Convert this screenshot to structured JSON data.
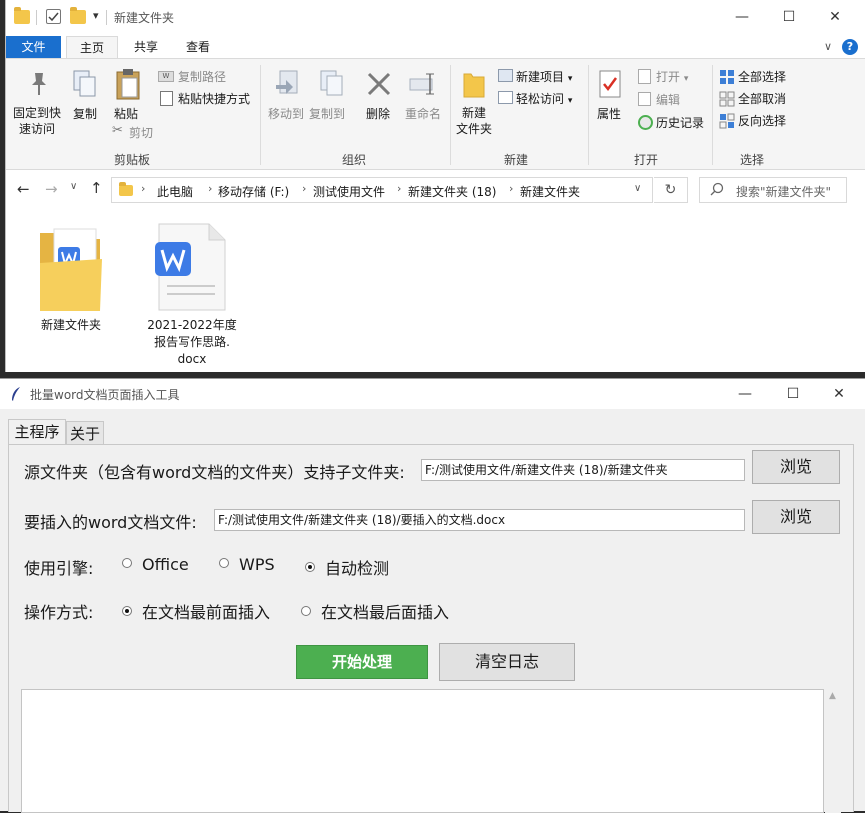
{
  "explorer": {
    "title": "新建文件夹",
    "window_controls": {
      "minimize": "—",
      "maximize": "☐",
      "close": "✕"
    },
    "tabs": [
      "文件",
      "主页",
      "共享",
      "查看"
    ],
    "ribbon": {
      "clipboard": {
        "pin": "固定到快\n速访问",
        "copy": "复制",
        "paste": "粘贴",
        "copy_path": "复制路径",
        "paste_shortcut": "粘贴快捷方式",
        "cut": "剪切",
        "group": "剪贴板"
      },
      "organize": {
        "move_to": "移动到",
        "copy_to": "复制到",
        "delete": "删除",
        "rename": "重命名",
        "group": "组织"
      },
      "new": {
        "new_folder": "新建\n文件夹",
        "new_item": "新建项目",
        "easy_access": "轻松访问",
        "group": "新建"
      },
      "open": {
        "properties": "属性",
        "open": "打开",
        "edit": "编辑",
        "history": "历史记录",
        "group": "打开"
      },
      "select": {
        "select_all": "全部选择",
        "select_none": "全部取消",
        "invert": "反向选择",
        "group": "选择"
      }
    },
    "address": [
      "此电脑",
      "移动存储 (F:)",
      "测试使用文件",
      "新建文件夹 (18)",
      "新建文件夹"
    ],
    "search_placeholder": "搜索\"新建文件夹\"",
    "files": [
      {
        "name": "新建文件夹",
        "type": "folder"
      },
      {
        "name": "2021-2022年度\n报告写作思路.\ndocx",
        "type": "docx"
      }
    ]
  },
  "tool": {
    "title": "批量word文档页面插入工具",
    "tabs": [
      "主程序",
      "关于"
    ],
    "source_label": "源文件夹（包含有word文档的文件夹）支持子文件夹:",
    "source_value": "F:/测试使用文件/新建文件夹 (18)/新建文件夹",
    "insert_label": "要插入的word文档文件:",
    "insert_value": "F:/测试使用文件/新建文件夹 (18)/要插入的文档.docx",
    "browse": "浏览",
    "engine_label": "使用引擎:",
    "engine_options": [
      "Office",
      "WPS",
      "自动检测"
    ],
    "engine_selected": "自动检测",
    "mode_label": "操作方式:",
    "mode_options": [
      "在文档最前面插入",
      "在文档最后面插入"
    ],
    "mode_selected": "在文档最前面插入",
    "start_button": "开始处理",
    "clear_button": "清空日志",
    "start_color": "#4caf50"
  }
}
